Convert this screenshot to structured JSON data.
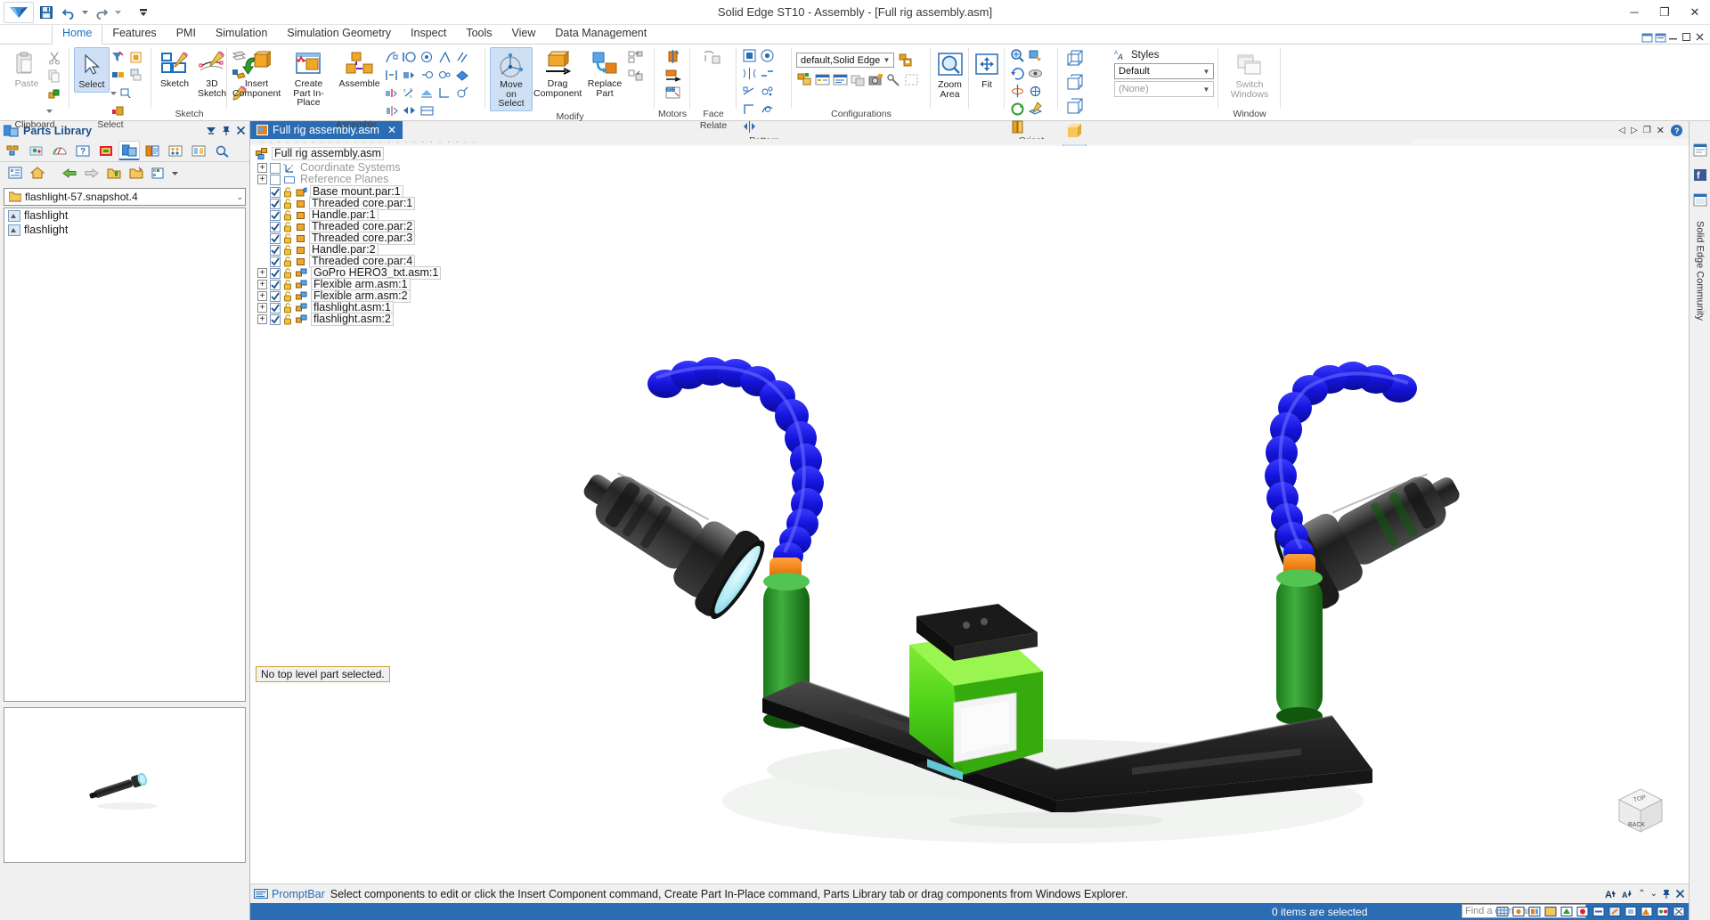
{
  "window": {
    "title": "Solid Edge ST10 - Assembly - [Full rig assembly.asm]",
    "minimize": "─",
    "maximize": "❐",
    "close": "✕"
  },
  "quick_access": {
    "app_button": "solid-edge-logo",
    "save": "save-icon",
    "undo": "undo-icon",
    "redo": "redo-icon",
    "customize": "customize-qat-icon"
  },
  "tabs": [
    {
      "label": "Home",
      "active": true
    },
    {
      "label": "Features",
      "active": false
    },
    {
      "label": "PMI",
      "active": false
    },
    {
      "label": "Simulation",
      "active": false
    },
    {
      "label": "Simulation Geometry",
      "active": false
    },
    {
      "label": "Inspect",
      "active": false
    },
    {
      "label": "Tools",
      "active": false
    },
    {
      "label": "View",
      "active": false
    },
    {
      "label": "Data Management",
      "active": false
    }
  ],
  "ribbon": {
    "groups": [
      {
        "name": "Clipboard",
        "label": "Clipboard",
        "big": [
          {
            "label": "Paste",
            "disabled": true,
            "icon": "paste-icon"
          }
        ],
        "small": [
          "cut-icon",
          "copy-icon",
          "copy-part-icon"
        ]
      },
      {
        "name": "Select",
        "label": "Select",
        "big": [
          {
            "label": "Select",
            "selected": true,
            "icon": "select-arrow-icon"
          }
        ],
        "small": [
          "select-filter-icon",
          "select-similar-icon",
          "select-all-icon",
          "select-tools-icon",
          "select-window-icon",
          "select-visible-icon"
        ]
      },
      {
        "name": "Sketch",
        "label": "Sketch",
        "big": [
          {
            "label": "Sketch",
            "icon": "sketch-icon"
          },
          {
            "label": "3D Sketch",
            "icon": "3d-sketch-icon"
          }
        ],
        "small": [
          "sketch-plane-icon",
          "sketch-region-icon",
          "sketch-edit-icon"
        ]
      },
      {
        "name": "Assemble",
        "label": "Assemble",
        "big": [
          {
            "label": "Insert Component",
            "icon": "insert-component-icon"
          },
          {
            "label": "Create Part In-Place",
            "icon": "create-part-inplace-icon"
          },
          {
            "label": "Assemble",
            "icon": "assemble-icon"
          }
        ],
        "small": [
          "relate-1-icon",
          "relate-2-icon",
          "relate-3-icon",
          "relate-4-icon",
          "relate-5-icon",
          "relate-6-icon",
          "relate-7-icon",
          "relate-8-icon",
          "relate-9-icon",
          "relate-10-icon",
          "relate-11-icon",
          "relate-12-icon",
          "relate-13-icon",
          "relate-14-icon",
          "relate-15-icon",
          "relate-16-icon",
          "relate-17-icon",
          "relate-18-icon"
        ]
      },
      {
        "name": "Modify",
        "label": "Modify",
        "big": [
          {
            "label": "Move on Select",
            "selected": true,
            "icon": "move-on-select-icon"
          },
          {
            "label": "Drag Component",
            "icon": "drag-component-icon"
          },
          {
            "label": "Replace Part",
            "icon": "replace-part-icon"
          }
        ],
        "small": [
          "mirror-components-icon",
          "pattern-copy-icon"
        ]
      },
      {
        "name": "Motors",
        "label": "Motors",
        "small": [
          "rotational-motor-icon",
          "linear-motor-icon",
          "motor-variable-icon"
        ]
      },
      {
        "name": "Face Relate",
        "label": "Face Relate",
        "small": [
          "face-relate-icon"
        ]
      },
      {
        "name": "Pattern",
        "label": "Pattern",
        "small": [
          "pattern-1-icon",
          "pattern-2-icon",
          "pattern-3-icon",
          "pattern-4-icon",
          "pattern-5-icon",
          "pattern-6-icon",
          "pattern-7-icon",
          "pattern-8-icon",
          "pattern-9-icon"
        ]
      },
      {
        "name": "Configurations",
        "label": "Configurations",
        "config_value": "default,Solid Edge",
        "small": [
          "display-config-icon",
          "zones-icon",
          "show-hide-icon",
          "alternate-assy-icon",
          "capture-fit-icon",
          "adjust-part-icon",
          "select-zone-icon"
        ]
      },
      {
        "name": "Zoom Area",
        "label": "",
        "big": [
          {
            "label": "Zoom Area",
            "icon": "zoom-area-icon"
          }
        ]
      },
      {
        "name": "Fit",
        "label": "",
        "big": [
          {
            "label": "Fit",
            "icon": "fit-icon"
          }
        ]
      },
      {
        "name": "Orient",
        "label": "Orient",
        "small": [
          "zoom-icon",
          "pan-icon",
          "rotate-icon",
          "look-at-icon",
          "sketch-view-icon",
          "common-views-icon",
          "spin-icon",
          "sketch-plane-view-icon",
          "section-icon"
        ]
      },
      {
        "name": "Style",
        "label": "Style",
        "styles_label": "Styles",
        "style_value": "Default",
        "style_none": "(None)",
        "small": [
          "wireframe-icon",
          "hidden-edge-icon",
          "visible-edge-icon",
          "shaded-icon",
          "shaded-edges-icon"
        ]
      },
      {
        "name": "Window",
        "label": "Window",
        "big": [
          {
            "label": "Switch Windows",
            "disabled": true,
            "icon": "switch-windows-icon"
          }
        ]
      }
    ]
  },
  "parts_library": {
    "title": "Parts Library",
    "pin_icon": "pin-icon",
    "close_icon": "close-icon",
    "dropdown_icon": "panel-menu-icon",
    "tabs": [
      "assembly-pathfinder-icon",
      "feature-library-icon",
      "sensors-icon",
      "unused-icon",
      "simulation-icon",
      "parts-library-icon",
      "layers-icon",
      "family-of-assy-icon",
      "alternate-assy-icon",
      "sensors2-icon",
      "find-icon"
    ],
    "toolbar": [
      "detail-view-icon",
      "home-folder-icon",
      "back-icon",
      "forward-icon",
      "up-folder-icon",
      "new-folder-icon",
      "views-icon"
    ],
    "path_value": "flashlight-57.snapshot.4",
    "items": [
      {
        "label": "flashlight",
        "icon": "part-file-icon"
      },
      {
        "label": "flashlight",
        "icon": "part-file-icon"
      }
    ],
    "preview_alt": "flashlight-preview"
  },
  "document": {
    "tab_label": "Full rig assembly.asm",
    "tab_icon": "assembly-doc-icon",
    "tab_close": "✕",
    "nav_icons": [
      "nav-prev-icon",
      "nav-next-icon",
      "nav-restore-icon",
      "nav-close-icon"
    ],
    "help_icon": "help-icon"
  },
  "tree": {
    "root": {
      "label": "Full rig assembly.asm",
      "icon": "assembly-icon"
    },
    "nodes": [
      {
        "label": "Coordinate Systems",
        "icon": "coordinate-systems-icon",
        "expandable": true,
        "checked": false,
        "greyed": true,
        "boxed": false,
        "indent": 0
      },
      {
        "label": "Reference Planes",
        "icon": "reference-planes-icon",
        "expandable": true,
        "checked": false,
        "greyed": true,
        "boxed": false,
        "indent": 0
      },
      {
        "label": "Base mount.par:1",
        "icon": "part-blue-icon",
        "expandable": false,
        "checked": true,
        "greyed": false,
        "boxed": true,
        "indent": 0
      },
      {
        "label": "Threaded core.par:1",
        "icon": "part-orange-icon",
        "expandable": false,
        "checked": true,
        "greyed": false,
        "boxed": true,
        "indent": 0
      },
      {
        "label": "Handle.par:1",
        "icon": "part-orange-icon",
        "expandable": false,
        "checked": true,
        "greyed": false,
        "boxed": true,
        "indent": 0
      },
      {
        "label": "Threaded core.par:2",
        "icon": "part-orange-icon",
        "expandable": false,
        "checked": true,
        "greyed": false,
        "boxed": true,
        "indent": 0
      },
      {
        "label": "Threaded core.par:3",
        "icon": "part-orange-icon",
        "expandable": false,
        "checked": true,
        "greyed": false,
        "boxed": true,
        "indent": 0
      },
      {
        "label": "Handle.par:2",
        "icon": "part-orange-icon",
        "expandable": false,
        "checked": true,
        "greyed": false,
        "boxed": true,
        "indent": 0
      },
      {
        "label": "Threaded core.par:4",
        "icon": "part-orange-icon",
        "expandable": false,
        "checked": true,
        "greyed": false,
        "boxed": true,
        "indent": 0
      },
      {
        "label": "GoPro HERO3_txt.asm:1",
        "icon": "subassembly-icon",
        "expandable": true,
        "checked": true,
        "greyed": false,
        "boxed": true,
        "indent": 0
      },
      {
        "label": "Flexible arm.asm:1",
        "icon": "subassembly-icon",
        "expandable": true,
        "checked": true,
        "greyed": false,
        "boxed": true,
        "indent": 0
      },
      {
        "label": "Flexible arm.asm:2",
        "icon": "subassembly-icon",
        "expandable": true,
        "checked": true,
        "greyed": false,
        "boxed": true,
        "indent": 0
      },
      {
        "label": "flashlight.asm:1",
        "icon": "subassembly-icon",
        "expandable": true,
        "checked": true,
        "greyed": false,
        "boxed": true,
        "indent": 0
      },
      {
        "label": "flashlight.asm:2",
        "icon": "subassembly-icon",
        "expandable": true,
        "checked": true,
        "greyed": false,
        "boxed": true,
        "indent": 0
      }
    ]
  },
  "viewport": {
    "prompt_chip": "No top level part selected.",
    "viewcube_top": "TOP",
    "viewcube_front": "BACK",
    "model_name": "flashlight-rig-3d-model"
  },
  "right_dock": {
    "items": [
      "command-finder-icon",
      "web-browser-icon",
      "solid-edge-community-label"
    ],
    "community_label": "Solid Edge Community"
  },
  "promptbar": {
    "label": "PromptBar",
    "icon": "promptbar-icon",
    "message": "Select components to edit or click the Insert Component command, Create Part In-Place command, Parts Library tab or drag components from Windows Explorer.",
    "right_icons": [
      "font-up-icon",
      "font-down-icon",
      "collapse-icon",
      "expand-icon",
      "pin-icon",
      "close-icon"
    ]
  },
  "statusbar": {
    "selection_text": "0 items are selected",
    "find_placeholder": "Find a command",
    "icons": [
      "grid-icon",
      "snap-icon",
      "layers-icon",
      "status-1-icon",
      "status-2-icon",
      "status-3-icon",
      "status-4-icon",
      "status-5-icon",
      "status-6-icon",
      "status-7-icon",
      "status-8-icon",
      "status-9-icon"
    ]
  },
  "colors": {
    "accent": "#2a6db5",
    "tab_active": "#1f6fc4",
    "body_green": "#3fc21a",
    "arm_blue": "#1a1ae6",
    "flashlight_black": "#2b2b2b",
    "lens_cyan": "#bff0f5",
    "handle_green": "#2e9e2e",
    "collar_orange": "#e8811a"
  }
}
